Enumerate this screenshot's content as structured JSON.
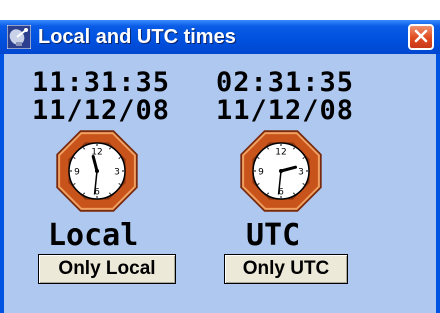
{
  "window": {
    "title": "Local and UTC times",
    "icon": "satellite-dish-icon",
    "close_icon": "close-icon"
  },
  "local": {
    "time": "11:31:35",
    "date": "11/12/08",
    "label": "Local",
    "button_label": "Only Local",
    "clock": {
      "hour": 11,
      "minute": 31
    }
  },
  "utc": {
    "time": "02:31:35",
    "date": "11/12/08",
    "label": "UTC",
    "button_label": "Only UTC",
    "clock": {
      "hour": 2,
      "minute": 31
    }
  },
  "colors": {
    "titlebar": "#0054e3",
    "client_background": "#aec8f0",
    "clock_frame": "#c0501a",
    "close_button": "#e04a1e"
  }
}
